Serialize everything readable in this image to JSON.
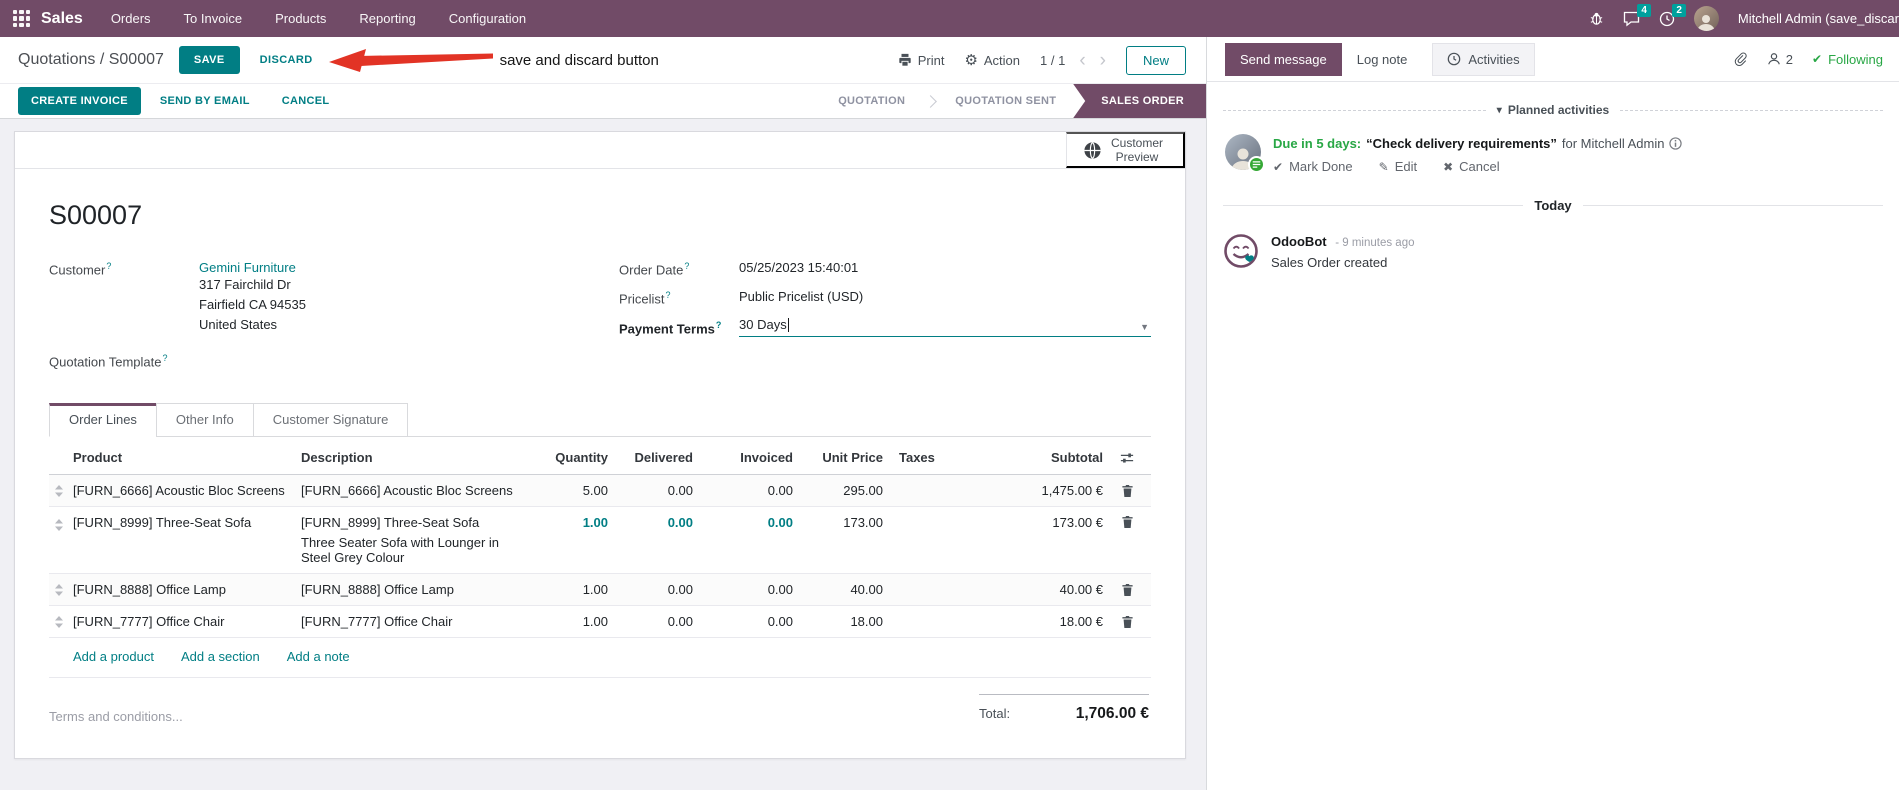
{
  "colors": {
    "brand": "#714B67",
    "accent": "#017E84",
    "badge": "#00A09D",
    "green": "#28a745",
    "annotation_red": "#e23325"
  },
  "nav": {
    "app_name": "Sales",
    "menus": [
      "Orders",
      "To Invoice",
      "Products",
      "Reporting",
      "Configuration"
    ],
    "messages_badge": "4",
    "activities_badge": "2",
    "user_name": "Mitchell Admin (save_discar"
  },
  "control_panel": {
    "breadcrumb_parent": "Quotations",
    "breadcrumb_separator": " / ",
    "breadcrumb_current": "S00007",
    "save_label": "SAVE",
    "discard_label": "DISCARD",
    "annotation": "save and discard button",
    "print_label": "Print",
    "action_label": "Action",
    "pager": "1 / 1",
    "prev_glyph": "‹",
    "next_glyph": "›",
    "new_label": "New"
  },
  "statusbar": {
    "buttons": [
      "CREATE INVOICE",
      "SEND BY EMAIL",
      "CANCEL"
    ],
    "states": [
      "QUOTATION",
      "QUOTATION SENT",
      "SALES ORDER"
    ]
  },
  "form": {
    "customer_preview_line1": "Customer",
    "customer_preview_line2": "Preview",
    "title": "S00007",
    "fields": {
      "customer_label": "Customer",
      "help_mark": "?",
      "customer_name": "Gemini Furniture",
      "address_line1": "317 Fairchild Dr",
      "address_line2": "Fairfield CA 94535",
      "address_line3": "United States",
      "quotation_template_label": "Quotation Template",
      "order_date_label": "Order Date",
      "order_date": "05/25/2023 15:40:01",
      "pricelist_label": "Pricelist",
      "pricelist": "Public Pricelist (USD)",
      "payment_terms_label": "Payment Terms",
      "payment_terms": "30 Days",
      "dropdown_glyph": "▼"
    },
    "tabs": [
      "Order Lines",
      "Other Info",
      "Customer Signature"
    ],
    "table": {
      "headers": [
        "Product",
        "Description",
        "Quantity",
        "Delivered",
        "Invoiced",
        "Unit Price",
        "Taxes",
        "Subtotal"
      ],
      "rows": [
        {
          "product": "[FURN_6666] Acoustic Bloc Screens",
          "description": "[FURN_6666] Acoustic Bloc Screens",
          "description2": "",
          "quantity": "5.00",
          "delivered": "0.00",
          "invoiced": "0.00",
          "unit_price": "295.00",
          "taxes": "",
          "subtotal": "1,475.00 €"
        },
        {
          "product": "[FURN_8999] Three-Seat Sofa",
          "description": "[FURN_8999] Three-Seat Sofa",
          "description2": "Three Seater Sofa with Lounger in Steel Grey Colour",
          "quantity": "1.00",
          "delivered": "0.00",
          "invoiced": "0.00",
          "unit_price": "173.00",
          "taxes": "",
          "subtotal": "173.00 €"
        },
        {
          "product": "[FURN_8888] Office Lamp",
          "description": "[FURN_8888] Office Lamp",
          "description2": "",
          "quantity": "1.00",
          "delivered": "0.00",
          "invoiced": "0.00",
          "unit_price": "40.00",
          "taxes": "",
          "subtotal": "40.00 €"
        },
        {
          "product": "[FURN_7777] Office Chair",
          "description": "[FURN_7777] Office Chair",
          "description2": "",
          "quantity": "1.00",
          "delivered": "0.00",
          "invoiced": "0.00",
          "unit_price": "18.00",
          "taxes": "",
          "subtotal": "18.00 €"
        }
      ],
      "footer_links": [
        "Add a product",
        "Add a section",
        "Add a note"
      ]
    },
    "terms_placeholder": "Terms and conditions...",
    "total_label": "Total:",
    "total_value": "1,706.00 €"
  },
  "chatter": {
    "send_message_label": "Send message",
    "log_note_label": "Log note",
    "activities_label": "Activities",
    "followers_count": "2",
    "following_label": "Following",
    "following_check": "✔",
    "planned_header": "Planned activities",
    "planned_caret": "▾",
    "activity": {
      "due": "Due in 5 days:",
      "summary": "“Check delivery requirements”",
      "for_user": "for Mitchell Admin",
      "mark_done": "Mark Done",
      "mark_done_glyph": "✔",
      "edit": "Edit",
      "edit_glyph": "✎",
      "cancel": "Cancel",
      "cancel_glyph": "✖"
    },
    "today_header": "Today",
    "message": {
      "author": "OdooBot",
      "time": "- 9 minutes ago",
      "body": "Sales Order created"
    }
  }
}
